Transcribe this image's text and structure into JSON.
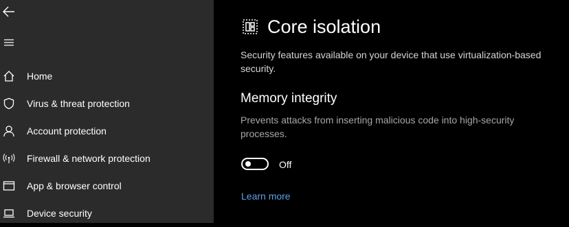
{
  "sidebar": {
    "items": [
      {
        "label": "Home",
        "icon": "home-icon"
      },
      {
        "label": "Virus & threat protection",
        "icon": "shield-icon"
      },
      {
        "label": "Account protection",
        "icon": "person-icon"
      },
      {
        "label": "Firewall & network protection",
        "icon": "wifi-broadcast-icon"
      },
      {
        "label": "App & browser control",
        "icon": "browser-window-icon"
      },
      {
        "label": "Device security",
        "icon": "laptop-icon"
      }
    ]
  },
  "main": {
    "title": "Core isolation",
    "description": "Security features available on your device that use virtualization-based security.",
    "section": {
      "title": "Memory integrity",
      "description": "Prevents attacks from inserting malicious code into high-security processes.",
      "toggle_state": "Off",
      "toggle_on": false
    },
    "learn_more": "Learn more"
  },
  "colors": {
    "sidebar_bg": "#2b2b2b",
    "main_bg": "#000000",
    "link": "#5ea1e6"
  }
}
